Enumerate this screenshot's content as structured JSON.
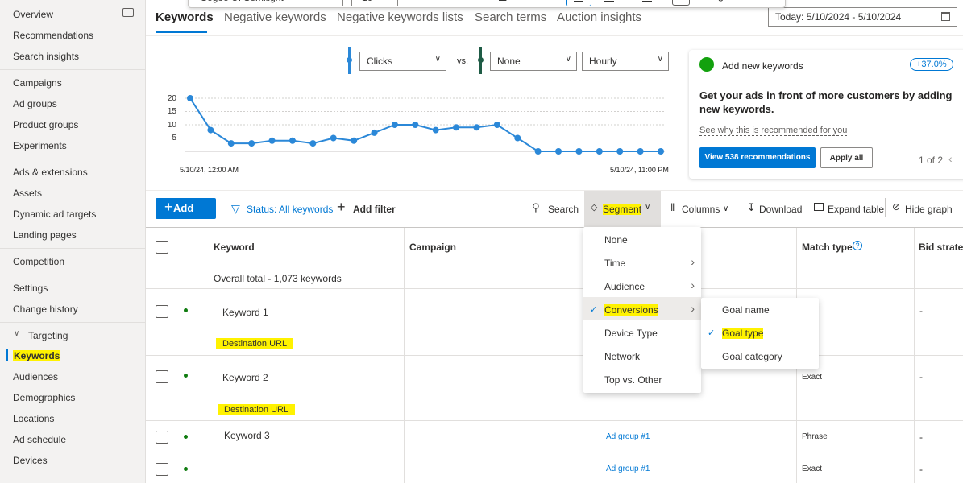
{
  "sidebar": {
    "items": [
      {
        "label": "Overview"
      },
      {
        "label": "Recommendations"
      },
      {
        "label": "Search insights"
      },
      {
        "label": "Campaigns"
      },
      {
        "label": "Ad groups"
      },
      {
        "label": "Product groups"
      },
      {
        "label": "Experiments"
      },
      {
        "label": "Ads & extensions"
      },
      {
        "label": "Assets"
      },
      {
        "label": "Dynamic ad targets"
      },
      {
        "label": "Landing pages"
      },
      {
        "label": "Competition"
      },
      {
        "label": "Settings"
      },
      {
        "label": "Change history"
      },
      {
        "label": "Targeting"
      },
      {
        "label": "Keywords"
      },
      {
        "label": "Audiences"
      },
      {
        "label": "Demographics"
      },
      {
        "label": "Locations"
      },
      {
        "label": "Ad schedule"
      },
      {
        "label": "Devices"
      }
    ]
  },
  "format_toolbar": {
    "font": "Segoe UI Semilight",
    "size": "10",
    "bold": "B",
    "italic": "I",
    "underline": "U",
    "strike": "S",
    "background_fill": "Background fill"
  },
  "tabs": [
    {
      "label": "Keywords"
    },
    {
      "label": "Negative keywords"
    },
    {
      "label": "Negative keywords lists"
    },
    {
      "label": "Search terms"
    },
    {
      "label": "Auction insights"
    }
  ],
  "date_range": "Today: 5/10/2024 - 5/10/2024",
  "chart_controls": {
    "metric1": "Clicks",
    "vs": "vs.",
    "metric2": "None",
    "granularity": "Hourly"
  },
  "chart_data": {
    "type": "line",
    "y_ticks": [
      "20",
      "15",
      "10",
      "5"
    ],
    "ylim": [
      0,
      22
    ],
    "x_start_label": "5/10/24, 12:00 AM",
    "x_end_label": "5/10/24, 11:00 PM",
    "series": [
      {
        "color": "#2b88d8",
        "values": [
          20,
          8,
          3,
          3,
          4,
          4,
          3,
          5,
          4,
          7,
          10,
          10,
          8,
          9,
          9,
          10,
          5,
          0,
          0,
          0,
          0,
          0,
          0,
          0
        ]
      }
    ]
  },
  "card": {
    "title": "Add new keywords",
    "badge": "+37.0%",
    "headline": "Get your ads in front of more customers by adding new keywords.",
    "link": "See why this is recommended for you",
    "primary_button": "View 538 recommendations",
    "secondary_button": "Apply all",
    "pager": "1 of 2"
  },
  "toolbar": {
    "add": "Add",
    "status": "Status: All keywords",
    "add_filter": "Add filter",
    "search": "Search",
    "segment": "Segment",
    "columns": "Columns",
    "download": "Download",
    "expand": "Expand table",
    "hide_graph": "Hide graph"
  },
  "table": {
    "headers": {
      "keyword": "Keyword",
      "campaign": "Campaign",
      "match_type": "Match type",
      "bid_strategy": "Bid strateg"
    },
    "overall_total": "Overall total - 1,073 keywords",
    "rows": [
      {
        "keyword": "Keyword 1",
        "ad_group": "",
        "match": "",
        "bid": "-"
      },
      {
        "keyword": "Destination URL"
      },
      {
        "keyword": "Keyword 2",
        "ad_group": "",
        "match": "Exact",
        "bid": "-"
      },
      {
        "keyword": "Destination URL"
      },
      {
        "keyword": "Keyword 3",
        "ad_group": "Ad group #1",
        "match": "Phrase",
        "bid": "-"
      },
      {
        "keyword": "",
        "ad_group": "Ad group #1",
        "match": "Exact",
        "bid": "-"
      }
    ]
  },
  "segment_menu": {
    "items": [
      {
        "label": "None"
      },
      {
        "label": "Time"
      },
      {
        "label": "Audience"
      },
      {
        "label": "Conversions"
      },
      {
        "label": "Device Type"
      },
      {
        "label": "Network"
      },
      {
        "label": "Top vs. Other"
      }
    ],
    "submenu": [
      {
        "label": "Goal name"
      },
      {
        "label": "Goal type"
      },
      {
        "label": "Goal category"
      }
    ]
  },
  "colors": {
    "accent": "#0078d4",
    "highlight": "#fff200",
    "line": "#2b88d8"
  }
}
